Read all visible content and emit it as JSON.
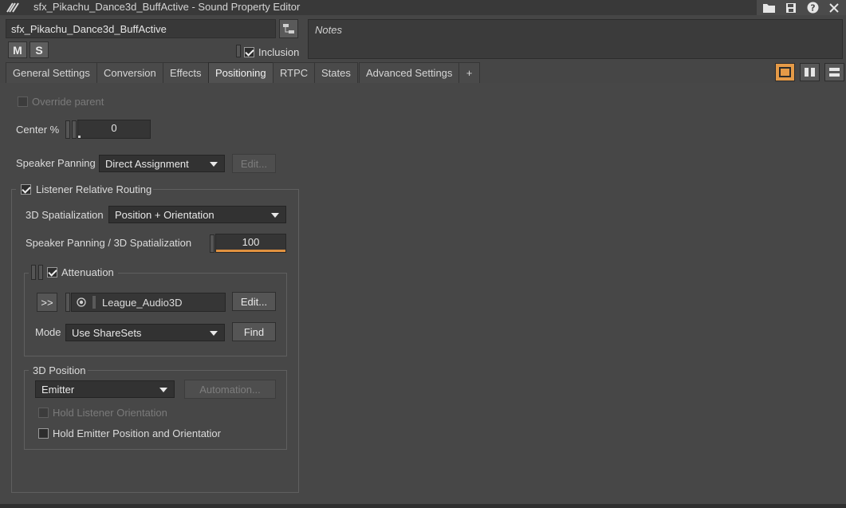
{
  "window": {
    "title": "sfx_Pikachu_Dance3d_BuffActive - Sound Property Editor"
  },
  "header": {
    "object_name": "sfx_Pikachu_Dance3d_BuffActive",
    "mute_label": "M",
    "solo_label": "S",
    "inclusion_label": "Inclusion",
    "inclusion_checked": true,
    "notes_placeholder": "Notes"
  },
  "tabs": [
    {
      "label": "General Settings",
      "active": false
    },
    {
      "label": "Conversion",
      "active": false
    },
    {
      "label": "Effects",
      "active": false
    },
    {
      "label": "Positioning",
      "active": true
    },
    {
      "label": "RTPC",
      "active": false
    },
    {
      "label": "States",
      "active": false
    },
    {
      "label": "Advanced Settings",
      "active": false
    },
    {
      "label": "+",
      "active": false
    }
  ],
  "positioning": {
    "override_parent_label": "Override parent",
    "override_parent_checked": false,
    "center_label": "Center %",
    "center_value": "0",
    "center_fraction": 0,
    "speaker_panning_label": "Speaker Panning",
    "speaker_panning_value": "Direct Assignment",
    "speaker_panning_edit": "Edit...",
    "listener_routing_label": "Listener Relative Routing",
    "listener_routing_checked": true,
    "spatialization_label": "3D Spatialization",
    "spatialization_value": "Position + Orientation",
    "mix_label": "Speaker Panning / 3D Spatialization",
    "mix_value": "100",
    "mix_fraction": 1.0,
    "attenuation": {
      "label": "Attenuation",
      "checked": true,
      "expand_label": ">>",
      "shareset_name": "League_Audio3D",
      "edit_label": "Edit...",
      "mode_label": "Mode",
      "mode_value": "Use ShareSets",
      "find_label": "Find"
    },
    "position3d": {
      "label": "3D Position",
      "value": "Emitter",
      "automation_label": "Automation...",
      "hold_listener_label": "Hold Listener Orientation",
      "hold_listener_checked": false,
      "hold_emitter_label": "Hold Emitter Position and Orientatior",
      "hold_emitter_checked": false
    }
  },
  "colors": {
    "accent": "#e0913f",
    "background": "#474747",
    "field": "#353535"
  }
}
